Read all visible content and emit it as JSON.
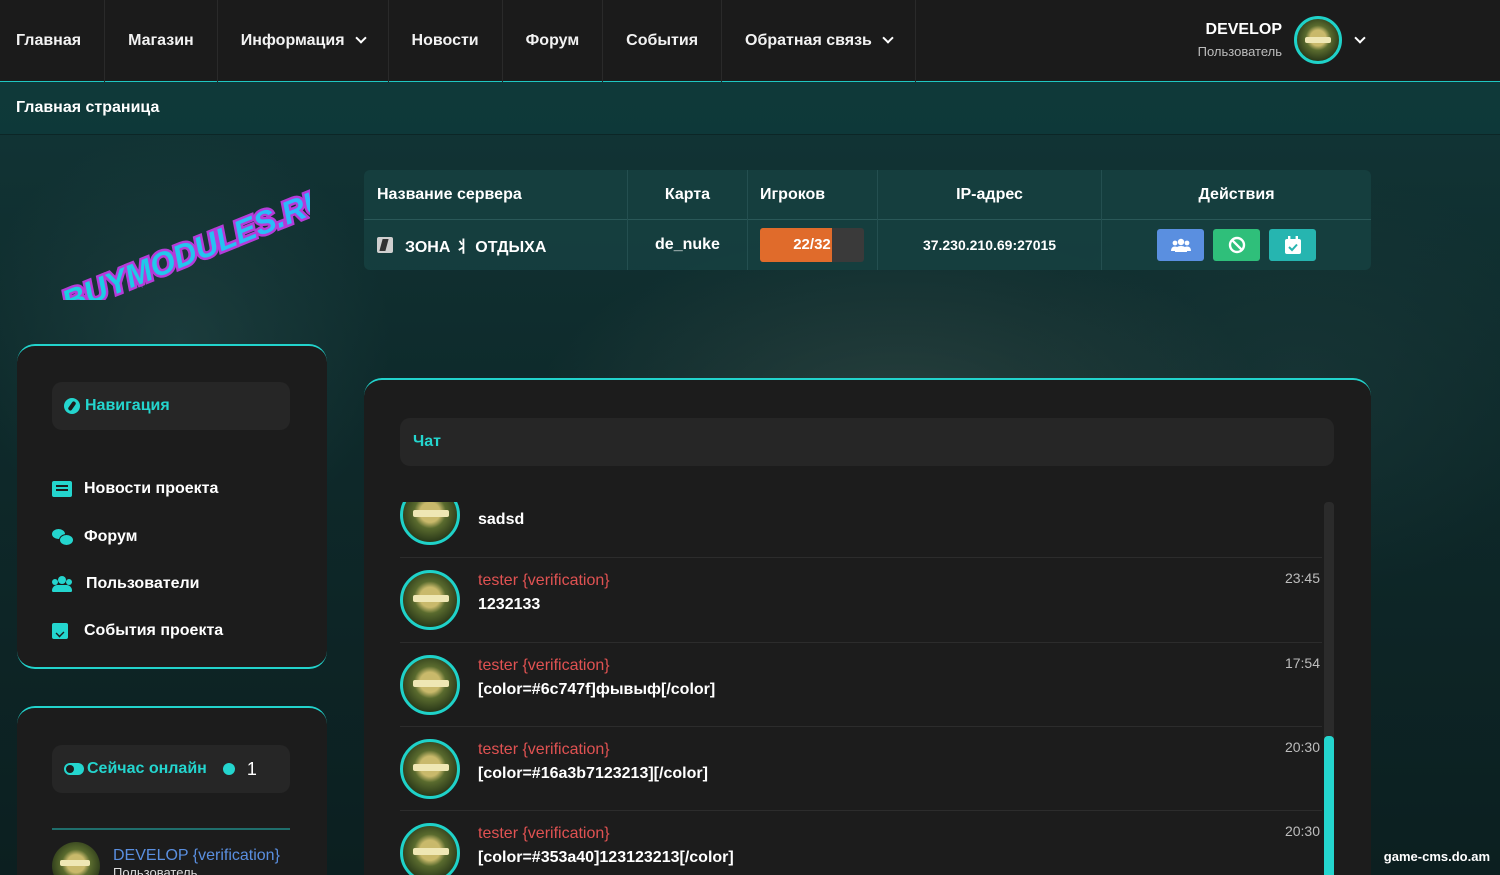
{
  "nav": {
    "items": [
      {
        "label": "Главная",
        "dropdown": false
      },
      {
        "label": "Магазин",
        "dropdown": false
      },
      {
        "label": "Информация",
        "dropdown": true
      },
      {
        "label": "Новости",
        "dropdown": false
      },
      {
        "label": "Форум",
        "dropdown": false
      },
      {
        "label": "События",
        "dropdown": false
      },
      {
        "label": "Обратная связь",
        "dropdown": true
      }
    ],
    "user": {
      "name": "DEVELOP",
      "role": "Пользователь"
    }
  },
  "breadcrumb": "Главная страница",
  "logo_text": "BUYMODULES.RU",
  "server_table": {
    "headers": [
      "Название сервера",
      "Карта",
      "Игроков",
      "IP-адрес",
      "Действия"
    ],
    "row": {
      "name": "ЗОНА ⺦ ОТДЫХА",
      "map": "de_nuke",
      "players": "22/32",
      "players_fraction": 0.6875,
      "ip": "37.230.210.69:27015",
      "actions": [
        "users-icon",
        "ban-icon",
        "calendar-check-icon"
      ]
    }
  },
  "sidebar": {
    "nav_title": "Навигация",
    "links": [
      {
        "label": "Новости проекта",
        "icon": "news-icon"
      },
      {
        "label": "Форум",
        "icon": "comments-icon"
      },
      {
        "label": "Пользователи",
        "icon": "users-icon"
      },
      {
        "label": "События проекта",
        "icon": "calendar-check-icon"
      }
    ],
    "online": {
      "title": "Сейчас онлайн",
      "count": "1",
      "user_name": "DEVELOP {verification}",
      "user_role": "Пользователь"
    }
  },
  "chat": {
    "title": "Чат",
    "messages": [
      {
        "author": "",
        "text": "sadsd",
        "time": ""
      },
      {
        "author": "tester {verification}",
        "text": "1232133",
        "time": "23:45"
      },
      {
        "author": "tester {verification}",
        "text": "[color=#6c747f]фывыф[/color]",
        "time": "17:54"
      },
      {
        "author": "tester {verification}",
        "text": "[color=#16a3b7123213][/color]",
        "time": "20:30"
      },
      {
        "author": "tester {verification}",
        "text": "[color=#353a40]123123213[/color]",
        "time": "20:30"
      }
    ]
  },
  "watermark": "game-cms.do.am",
  "colors": {
    "accent": "#22d3cc",
    "author": "#e05252",
    "players_fill": "#e06b2b"
  }
}
